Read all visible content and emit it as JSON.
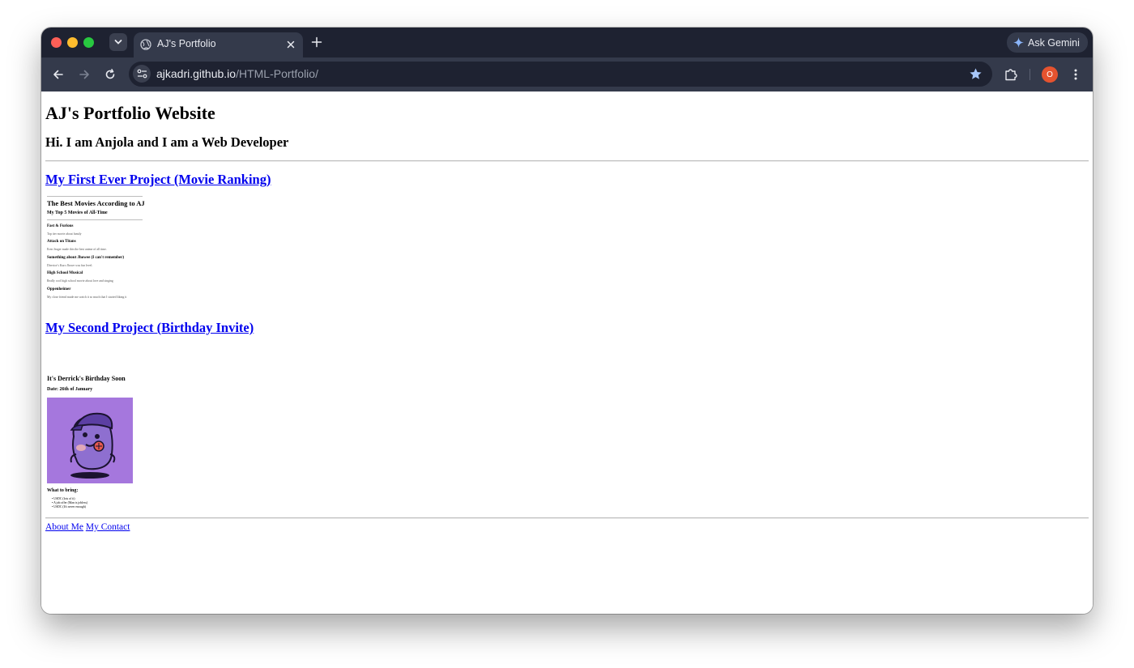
{
  "browser": {
    "tab_title": "AJ's Portfolio",
    "gemini_label": "Ask Gemini",
    "url_host": "ajkadri.github.io",
    "url_path": "/HTML-Portfolio/",
    "avatar_letter": "O"
  },
  "page": {
    "title": "AJ's Portfolio Website",
    "intro": "Hi. I am Anjola and I am a Web Developer",
    "project1": {
      "link": "My First Ever Project (Movie Ranking)",
      "heading": "The Best Movies According to AJ",
      "subheading": "My Top 5 Movies of All-Time",
      "movies": [
        {
          "title": "Fast & Furious",
          "desc": "Top tier movie about family"
        },
        {
          "title": "Attack on Titans",
          "desc": "Eren Jeager made this the best anime of all time."
        },
        {
          "title": "Something about Jhowee (I can't remember)",
          "desc": "Director's Kuro Jhowe was fun level."
        },
        {
          "title": "High School Musical",
          "desc": "Really cool high school movie about love and singing"
        },
        {
          "title": "Oppenheimer",
          "desc": "My close friend made me watch it so much that I started liking it"
        }
      ]
    },
    "project2": {
      "link": "My Second Project (Birthday Invite)",
      "heading": "It's Derrick's Birthday Soon",
      "date": "Date: 26th of January",
      "bring_heading": "What to bring:",
      "bring_items": [
        "USDC (lots of it)",
        "A job offer (Man is jobless)",
        "USDC (It's never enough)"
      ]
    },
    "footer": {
      "about": "About Me",
      "contact": "My Contact"
    }
  },
  "colors": {
    "tabstrip": "#1e2231",
    "toolbar": "#343a4b",
    "link": "#0000ee",
    "birthday_bg": "#a577dd",
    "avatar": "#e5532f"
  }
}
